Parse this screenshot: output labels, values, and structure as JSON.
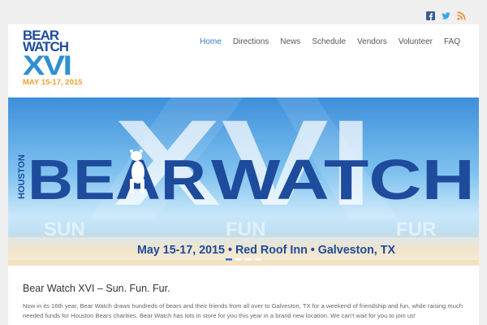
{
  "colors": {
    "brand_blue": "#1e4b9c",
    "accent_blue": "#2e8fd3",
    "accent_orange": "#f0a030",
    "nav_active": "#3a78c4"
  },
  "social": {
    "icons": [
      "facebook-icon",
      "twitter-icon",
      "rss-icon"
    ]
  },
  "logo": {
    "line1": "BEAR",
    "line2": "WATCH",
    "line3": "XVI",
    "line4": "MAY 15-17, 2015"
  },
  "nav": {
    "items": [
      "Home",
      "Directions",
      "News",
      "Schedule",
      "Vendors",
      "Volunteer",
      "FAQ"
    ],
    "active": "Home"
  },
  "hero": {
    "roman": "XVI",
    "houston": "HOUSTON",
    "bear": "BEAR",
    "watch": "WATCH",
    "words": [
      "SUN",
      "FUN",
      "FUR"
    ],
    "banner": "May 15-17, 2015 • Red Roof Inn • Galveston, TX",
    "slides_total": 4,
    "slide_active": 1
  },
  "content": {
    "title": "Bear Watch XVI – Sun. Fun. Fur.",
    "body": "Now in its 16th year, Bear Watch draws hundreds of bears and their friends from all over to Galveston, TX for a weekend of friendship and fun, while raising much needed funds for Houston Bears charities. Bear Watch has lots in store for you this year in a brand new location. We can't wait for you to join us!"
  }
}
